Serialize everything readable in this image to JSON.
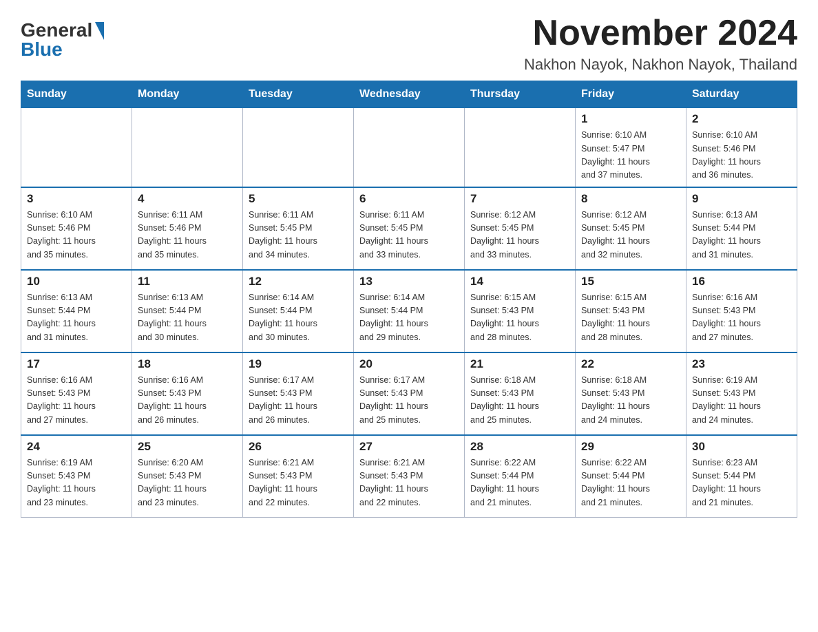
{
  "header": {
    "logo_general": "General",
    "logo_blue": "Blue",
    "month": "November 2024",
    "location": "Nakhon Nayok, Nakhon Nayok, Thailand"
  },
  "days_of_week": [
    "Sunday",
    "Monday",
    "Tuesday",
    "Wednesday",
    "Thursday",
    "Friday",
    "Saturday"
  ],
  "weeks": [
    [
      {
        "day": "",
        "info": ""
      },
      {
        "day": "",
        "info": ""
      },
      {
        "day": "",
        "info": ""
      },
      {
        "day": "",
        "info": ""
      },
      {
        "day": "",
        "info": ""
      },
      {
        "day": "1",
        "info": "Sunrise: 6:10 AM\nSunset: 5:47 PM\nDaylight: 11 hours\nand 37 minutes."
      },
      {
        "day": "2",
        "info": "Sunrise: 6:10 AM\nSunset: 5:46 PM\nDaylight: 11 hours\nand 36 minutes."
      }
    ],
    [
      {
        "day": "3",
        "info": "Sunrise: 6:10 AM\nSunset: 5:46 PM\nDaylight: 11 hours\nand 35 minutes."
      },
      {
        "day": "4",
        "info": "Sunrise: 6:11 AM\nSunset: 5:46 PM\nDaylight: 11 hours\nand 35 minutes."
      },
      {
        "day": "5",
        "info": "Sunrise: 6:11 AM\nSunset: 5:45 PM\nDaylight: 11 hours\nand 34 minutes."
      },
      {
        "day": "6",
        "info": "Sunrise: 6:11 AM\nSunset: 5:45 PM\nDaylight: 11 hours\nand 33 minutes."
      },
      {
        "day": "7",
        "info": "Sunrise: 6:12 AM\nSunset: 5:45 PM\nDaylight: 11 hours\nand 33 minutes."
      },
      {
        "day": "8",
        "info": "Sunrise: 6:12 AM\nSunset: 5:45 PM\nDaylight: 11 hours\nand 32 minutes."
      },
      {
        "day": "9",
        "info": "Sunrise: 6:13 AM\nSunset: 5:44 PM\nDaylight: 11 hours\nand 31 minutes."
      }
    ],
    [
      {
        "day": "10",
        "info": "Sunrise: 6:13 AM\nSunset: 5:44 PM\nDaylight: 11 hours\nand 31 minutes."
      },
      {
        "day": "11",
        "info": "Sunrise: 6:13 AM\nSunset: 5:44 PM\nDaylight: 11 hours\nand 30 minutes."
      },
      {
        "day": "12",
        "info": "Sunrise: 6:14 AM\nSunset: 5:44 PM\nDaylight: 11 hours\nand 30 minutes."
      },
      {
        "day": "13",
        "info": "Sunrise: 6:14 AM\nSunset: 5:44 PM\nDaylight: 11 hours\nand 29 minutes."
      },
      {
        "day": "14",
        "info": "Sunrise: 6:15 AM\nSunset: 5:43 PM\nDaylight: 11 hours\nand 28 minutes."
      },
      {
        "day": "15",
        "info": "Sunrise: 6:15 AM\nSunset: 5:43 PM\nDaylight: 11 hours\nand 28 minutes."
      },
      {
        "day": "16",
        "info": "Sunrise: 6:16 AM\nSunset: 5:43 PM\nDaylight: 11 hours\nand 27 minutes."
      }
    ],
    [
      {
        "day": "17",
        "info": "Sunrise: 6:16 AM\nSunset: 5:43 PM\nDaylight: 11 hours\nand 27 minutes."
      },
      {
        "day": "18",
        "info": "Sunrise: 6:16 AM\nSunset: 5:43 PM\nDaylight: 11 hours\nand 26 minutes."
      },
      {
        "day": "19",
        "info": "Sunrise: 6:17 AM\nSunset: 5:43 PM\nDaylight: 11 hours\nand 26 minutes."
      },
      {
        "day": "20",
        "info": "Sunrise: 6:17 AM\nSunset: 5:43 PM\nDaylight: 11 hours\nand 25 minutes."
      },
      {
        "day": "21",
        "info": "Sunrise: 6:18 AM\nSunset: 5:43 PM\nDaylight: 11 hours\nand 25 minutes."
      },
      {
        "day": "22",
        "info": "Sunrise: 6:18 AM\nSunset: 5:43 PM\nDaylight: 11 hours\nand 24 minutes."
      },
      {
        "day": "23",
        "info": "Sunrise: 6:19 AM\nSunset: 5:43 PM\nDaylight: 11 hours\nand 24 minutes."
      }
    ],
    [
      {
        "day": "24",
        "info": "Sunrise: 6:19 AM\nSunset: 5:43 PM\nDaylight: 11 hours\nand 23 minutes."
      },
      {
        "day": "25",
        "info": "Sunrise: 6:20 AM\nSunset: 5:43 PM\nDaylight: 11 hours\nand 23 minutes."
      },
      {
        "day": "26",
        "info": "Sunrise: 6:21 AM\nSunset: 5:43 PM\nDaylight: 11 hours\nand 22 minutes."
      },
      {
        "day": "27",
        "info": "Sunrise: 6:21 AM\nSunset: 5:43 PM\nDaylight: 11 hours\nand 22 minutes."
      },
      {
        "day": "28",
        "info": "Sunrise: 6:22 AM\nSunset: 5:44 PM\nDaylight: 11 hours\nand 21 minutes."
      },
      {
        "day": "29",
        "info": "Sunrise: 6:22 AM\nSunset: 5:44 PM\nDaylight: 11 hours\nand 21 minutes."
      },
      {
        "day": "30",
        "info": "Sunrise: 6:23 AM\nSunset: 5:44 PM\nDaylight: 11 hours\nand 21 minutes."
      }
    ]
  ]
}
